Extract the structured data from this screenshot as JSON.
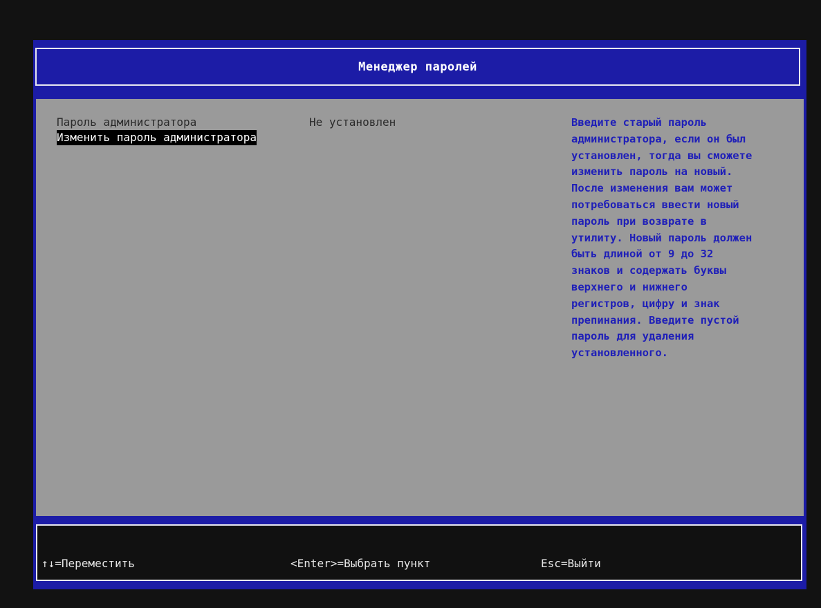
{
  "header": {
    "title": "Менеджер паролей"
  },
  "settings": [
    {
      "label": "Пароль администратора",
      "value": "Не установлен"
    },
    {
      "label": "Изменить пароль администратора",
      "value": ""
    }
  ],
  "help": {
    "text": "Введите старый пароль\nадминистратора, если он был\nустановлен, тогда вы сможете\nизменить пароль на новый.\nПосле изменения вам может\nпотребоваться ввести новый\nпароль при возврате в\nутилиту. Новый пароль должен\nбыть длиной от 9 до 32\nзнаков и содержать буквы\nверхнего и нижнего\nрегистров, цифру и знак\nпрепинания. Введите пустой\nпароль для удаления\nустановленного."
  },
  "footer": {
    "move": "↑↓=Переместить",
    "select": "<Enter>=Выбрать пункт",
    "exit": "Esc=Выйти"
  },
  "colors": {
    "frame_blue": "#1c1ca6",
    "content_gray": "#9a9a9a",
    "help_blue": "#1f1fb8",
    "selection_bg": "#000000"
  }
}
